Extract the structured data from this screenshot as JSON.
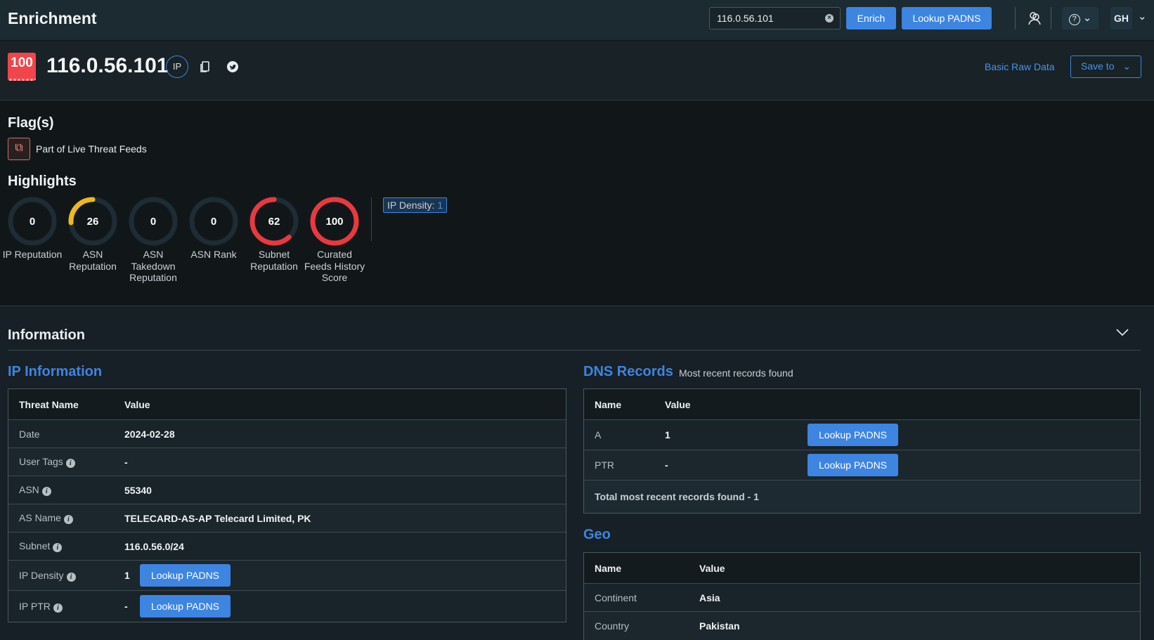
{
  "app": {
    "title": "Enrichment"
  },
  "topbar": {
    "search_value": "116.0.56.101",
    "enrich_label": "Enrich",
    "lookup_label": "Lookup PADNS",
    "user_initials": "GH",
    "help_icon": "?"
  },
  "indicator": {
    "score": "100",
    "ip": "116.0.56.101",
    "type_badge": "IP",
    "basic_raw_data": "Basic Raw Data",
    "save_to": "Save to",
    "score_color": "#f0454a"
  },
  "flags": {
    "title": "Flag(s)",
    "items": [
      {
        "label": "Part of Live Threat Feeds"
      }
    ]
  },
  "highlights": {
    "title": "Highlights",
    "items": [
      {
        "value": "0",
        "label": "IP Reputation",
        "percent": 0,
        "color": "#f0454a"
      },
      {
        "value": "26",
        "label": "ASN Reputation",
        "percent": 26,
        "color": "#f0b71d"
      },
      {
        "value": "0",
        "label": "ASN Takedown Reputation",
        "percent": 0,
        "color": "#f0454a"
      },
      {
        "value": "0",
        "label": "ASN Rank",
        "percent": 0,
        "color": "#f0454a"
      },
      {
        "value": "62",
        "label": "Subnet Reputation",
        "percent": 62,
        "color": "#e8393f"
      },
      {
        "value": "100",
        "label": "Curated Feeds History Score",
        "percent": 100,
        "color": "#e8393f"
      }
    ],
    "density_label": "IP Density:",
    "density_value": "1"
  },
  "information": {
    "title": "Information"
  },
  "ip_info": {
    "title": "IP Information",
    "headers": [
      "Threat Name",
      "Value"
    ],
    "rows": [
      {
        "name": "Date",
        "value": "2024-02-28",
        "info": false,
        "button": null
      },
      {
        "name": "User Tags",
        "value": "-",
        "info": true,
        "button": null
      },
      {
        "name": "ASN",
        "value": "55340",
        "info": true,
        "button": null
      },
      {
        "name": "AS Name",
        "value": "TELECARD-AS-AP Telecard Limited, PK",
        "info": true,
        "button": null
      },
      {
        "name": "Subnet",
        "value": "116.0.56.0/24",
        "info": true,
        "button": null
      },
      {
        "name": "IP Density",
        "value": "1",
        "info": true,
        "button": "Lookup PADNS"
      },
      {
        "name": "IP PTR",
        "value": "-",
        "info": true,
        "button": "Lookup PADNS"
      }
    ]
  },
  "dns": {
    "title": "DNS Records",
    "subtitle": "Most recent records found",
    "headers": [
      "Name",
      "Value"
    ],
    "rows": [
      {
        "name": "A",
        "value": "1",
        "button": "Lookup PADNS"
      },
      {
        "name": "PTR",
        "value": "-",
        "button": "Lookup PADNS"
      }
    ],
    "total": "Total most recent records found - 1"
  },
  "geo": {
    "title": "Geo",
    "headers": [
      "Name",
      "Value"
    ],
    "rows": [
      {
        "name": "Continent",
        "value": "Asia"
      },
      {
        "name": "Country",
        "value": "Pakistan"
      }
    ]
  }
}
